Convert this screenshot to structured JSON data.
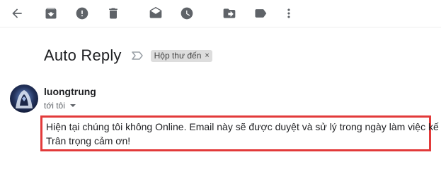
{
  "toolbar": {
    "icons": [
      "back-arrow-icon",
      "archive-icon",
      "report-spam-icon",
      "delete-icon",
      "mark-unread-icon",
      "snooze-icon",
      "move-to-icon",
      "label-icon",
      "more-vert-icon"
    ]
  },
  "email": {
    "subject": "Auto Reply",
    "label": "Hộp thư đến",
    "label_remove": "×",
    "sender": "luongtrung",
    "recipient": "tới tôi",
    "body_lines": [
      "Hiện tại chúng tôi không Online. Email này sẽ được duyệt và sử lý trong ngày làm việc kế tiếp",
      "Trân trọng cảm ơn!"
    ]
  },
  "colors": {
    "icon": "#5f6368",
    "highlight_border": "#e23a3a",
    "chip_bg": "#dddddd",
    "avatar_bg": "#2c3e64"
  }
}
